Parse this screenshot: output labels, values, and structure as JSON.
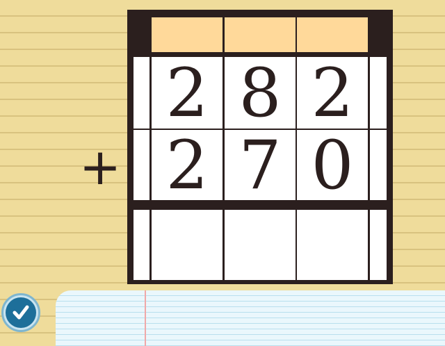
{
  "problem": {
    "operator": "+",
    "top_digits": [
      "2",
      "8",
      "2"
    ],
    "bottom_digits": [
      "2",
      "7",
      "0"
    ],
    "carry_row": [
      "",
      "",
      ""
    ],
    "answer_digits": [
      "",
      "",
      ""
    ]
  },
  "controls": {
    "check_icon": "checkmark-icon"
  },
  "colors": {
    "paper": "#efdc9b",
    "board": "#2b1f1e",
    "carry": "#ffd99a",
    "cell": "#ffffff",
    "answer_paper": "#eaf7fc",
    "button": "#1d6f9a"
  }
}
